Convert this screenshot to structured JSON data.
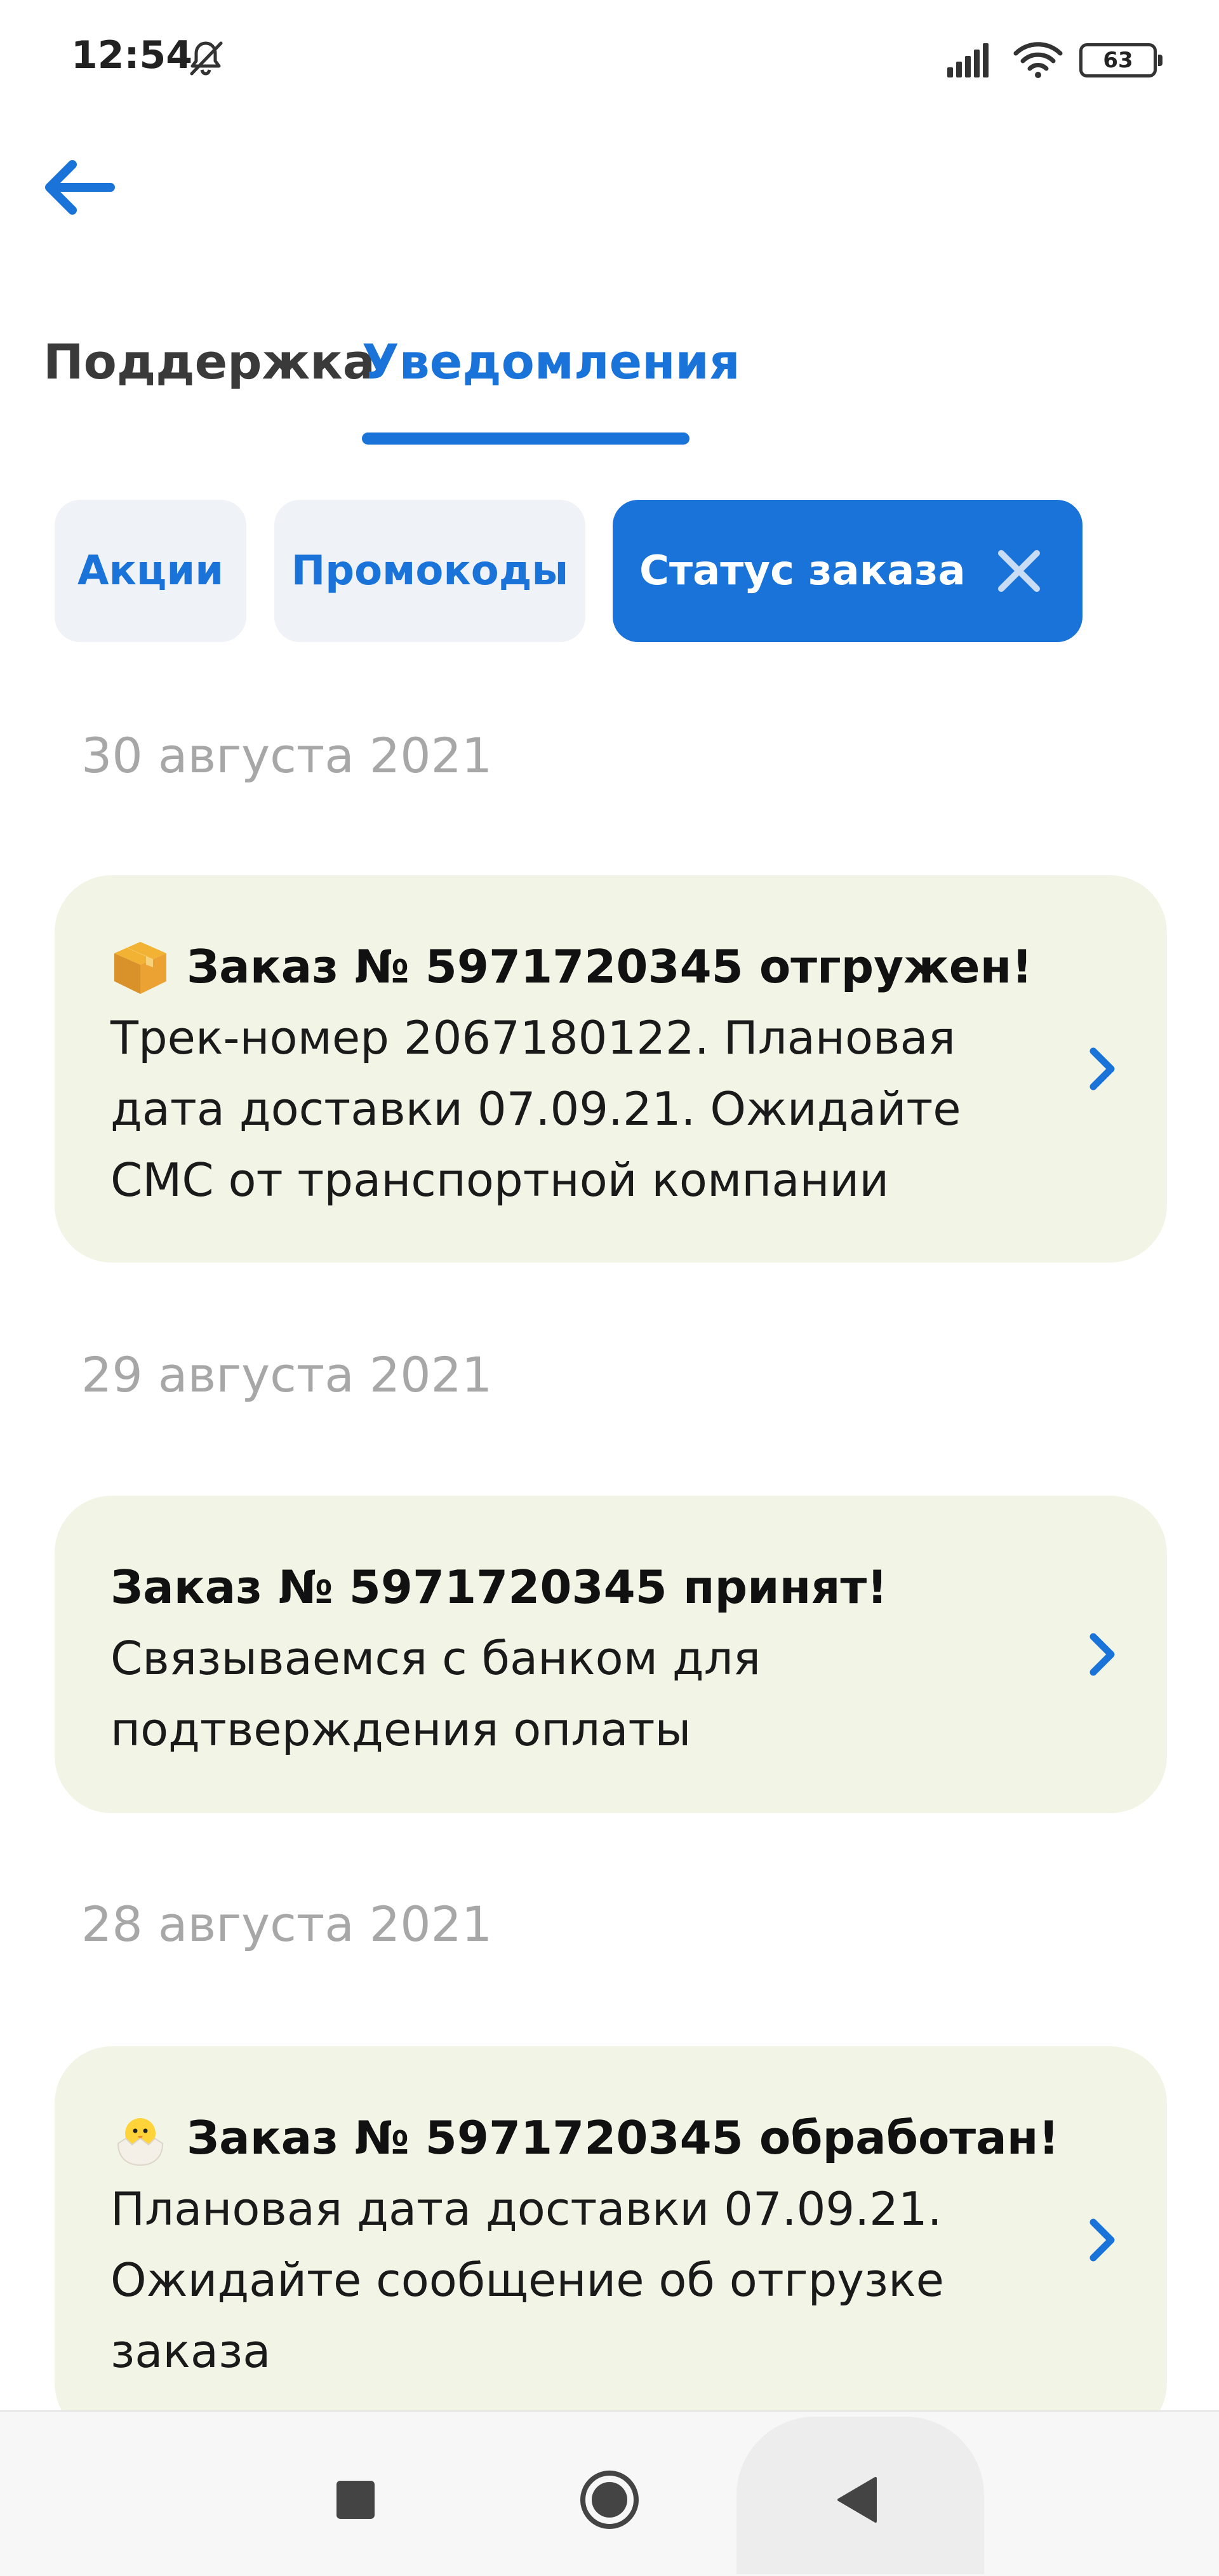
{
  "status_bar": {
    "time": "12:54",
    "battery": "63",
    "icons": [
      "bell-off-icon",
      "signal-icon",
      "wifi-icon",
      "battery-icon"
    ]
  },
  "header": {
    "back_icon": "arrow-left-icon"
  },
  "tabs": [
    {
      "label": "Поддержка",
      "active": false
    },
    {
      "label": "Уведомления",
      "active": true
    }
  ],
  "filters": [
    {
      "label": "Акции",
      "selected": false
    },
    {
      "label": "Промокоды",
      "selected": false
    },
    {
      "label": "Статус заказа",
      "selected": true
    }
  ],
  "notifications": [
    {
      "date": "30 августа 2021",
      "emoji": "package-icon",
      "title": "Заказ № 5971720345 отгружен!",
      "body": "Трек-номер 2067180122.  Плановая дата доставки 07.09.21. Ожидайте СМС от транспортной компании"
    },
    {
      "date": "29 августа 2021",
      "emoji": "",
      "title": "Заказ № 5971720345 принят!",
      "body": "Связываемся с банком для подтверждения оплаты"
    },
    {
      "date": "28 августа 2021",
      "emoji": "hatching-chick-icon",
      "title": "Заказ № 5971720345 обработан!",
      "body": "Плановая дата доставки 07.09.21. Ожидайте сообщение об отгрузке заказа"
    }
  ],
  "colors": {
    "accent": "#1a73d9",
    "card_background": "#f2f5e6",
    "chip_background": "#eff3f8",
    "date_text": "#a7a7a7"
  }
}
